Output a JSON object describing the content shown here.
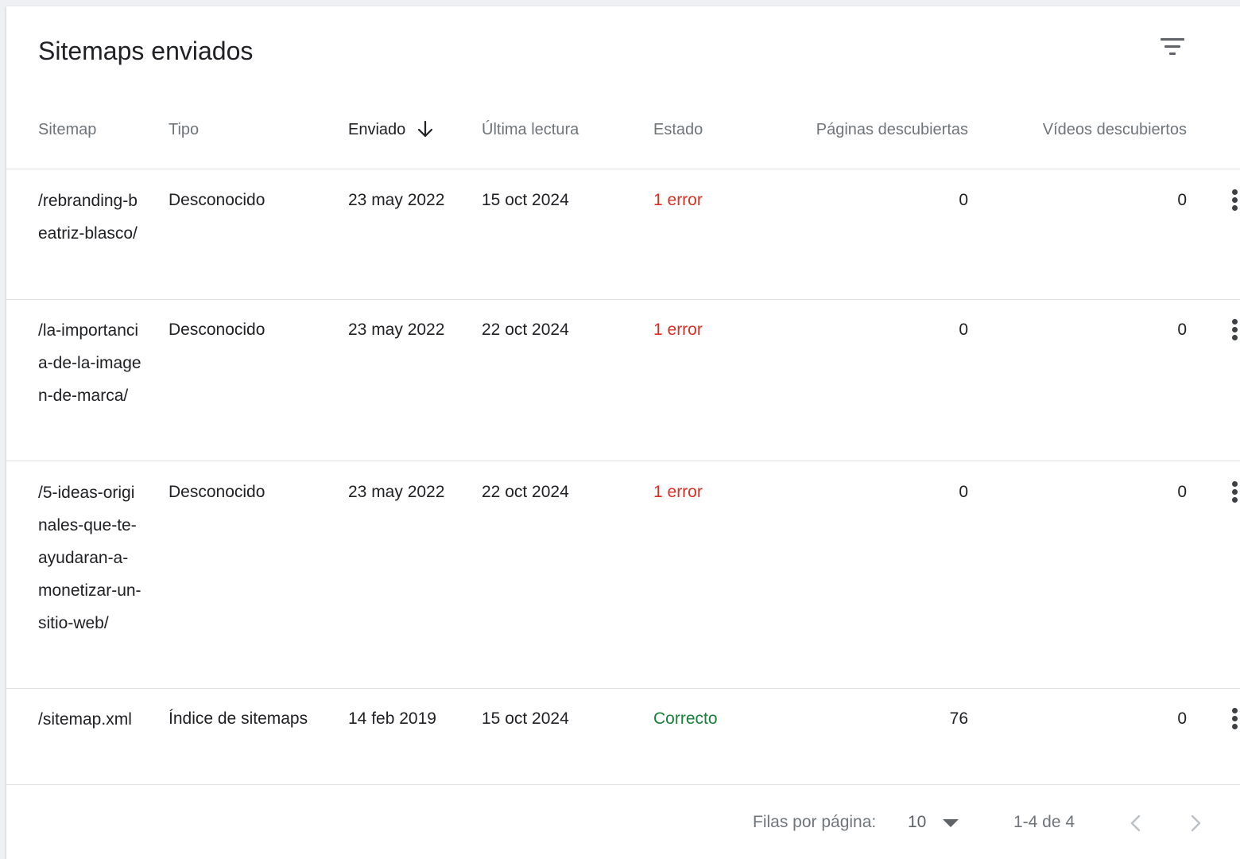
{
  "card": {
    "title": "Sitemaps enviados",
    "filter_icon": "filter-list-icon"
  },
  "table": {
    "columns": [
      "Sitemap",
      "Tipo",
      "Enviado",
      "Última lectura",
      "Estado",
      "Páginas descubiertas",
      "Vídeos descubiertos"
    ],
    "sorted_column": "Enviado",
    "sort_icon": "arrow-down-icon",
    "rows": [
      {
        "sitemap": "/rebranding-beatriz-blasco/",
        "tipo": "Desconocido",
        "enviado": "23 may 2022",
        "ultima_lectura": "15 oct 2024",
        "estado": "1 error",
        "paginas": "0",
        "videos": "0"
      },
      {
        "sitemap": "/la-importancia-de-la-imagen-de-marca/",
        "tipo": "Desconocido",
        "enviado": "23 may 2022",
        "ultima_lectura": "22 oct 2024",
        "estado": "1 error",
        "paginas": "0",
        "videos": "0"
      },
      {
        "sitemap": "/5-ideas-originales-que-te-ayudaran-a-monetizar-un-sitio-web/",
        "tipo": "Desconocido",
        "enviado": "23 may 2022",
        "ultima_lectura": "22 oct 2024",
        "estado": "1 error",
        "paginas": "0",
        "videos": "0"
      },
      {
        "sitemap": "/sitemap.xml",
        "tipo": "Índice de sitemaps",
        "enviado": "14 feb 2019",
        "ultima_lectura": "15 oct 2024",
        "estado": "Correcto",
        "paginas": "76",
        "videos": "0"
      }
    ],
    "row_menu_icon": "more-vert-icon"
  },
  "footer": {
    "rows_per_page_label": "Filas por página:",
    "rows_per_page_value": "10",
    "range": "1-4 de 4",
    "prev_icon": "chevron-left-icon",
    "next_icon": "chevron-right-icon"
  },
  "colors": {
    "error": "#d93025",
    "success": "#188038",
    "header_text": "#70757a",
    "text": "#202124"
  }
}
